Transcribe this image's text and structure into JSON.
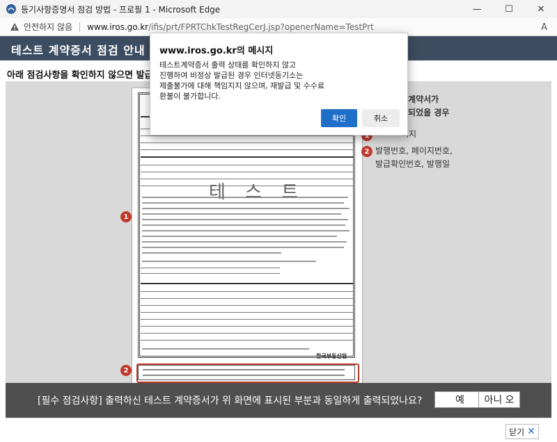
{
  "window": {
    "title": "등기사항증명서 점검 방법 - 프로필 1 - Microsoft Edge",
    "minimize_glyph": "—",
    "maximize_glyph": "☐",
    "close_glyph": "✕"
  },
  "addressbar": {
    "security_label": "안전하지 않음",
    "host": "www.iros.go.kr",
    "path": "/ifis/prt/FPRTChkTestRegCerJ.jsp?openerName=TestPrt",
    "reader_icon": "A"
  },
  "page": {
    "header_title": "테스트 계약증서 점검 안내",
    "instruction": "아래 점검사항을 확인하지 않으면 발급",
    "certificate": {
      "stamp_text": "테 스 트",
      "logo_text": "한국부동산원"
    },
    "markers": {
      "one": "1",
      "two": "2"
    },
    "legend": {
      "heading_line1": "차계약서가",
      "heading_line2": "력되었을 경우",
      "item1": "미지",
      "item2_line1": "발행번호, 페이지번호,",
      "item2_line2": "발급확인번호, 발행일"
    },
    "question": "[필수 점검사항] 출력하신 테스트 계약증서가 위 화면에 표시된 부분과 동일하게 출력되었나요?",
    "yes_label": "예",
    "no_label": "아니 오",
    "close_label": "닫기"
  },
  "dialog": {
    "title": "www.iros.go.kr의 메시지",
    "message": "테스트계약증서 출력 상태를 확인하지 않고\n진행하여 비정상 발급된 경우 인터넷등기소는\n제출불가에 대해 책임지지 않으며, 재발급 및 수수료\n환불이 불가합니다.",
    "ok_label": "확인",
    "cancel_label": "취소"
  },
  "colors": {
    "header_bg": "#3c4d61",
    "marker_red": "#c0392b",
    "dialog_ok_blue": "#1f6fc8",
    "question_bar_bg": "#4f4f4f"
  },
  "icons": [
    "app-icon",
    "warning-icon",
    "reader-mode-icon",
    "close-x-icon"
  ]
}
